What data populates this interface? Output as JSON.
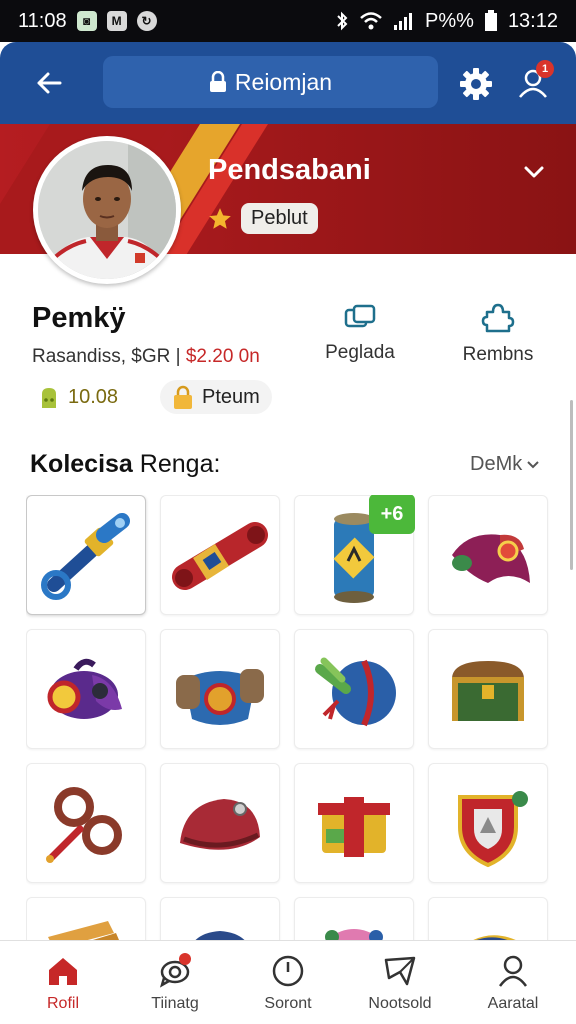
{
  "status_bar": {
    "time_left": "11:08",
    "battery_text": "P%%",
    "time_right": "13:12"
  },
  "app_bar": {
    "search_text": "Reiomjan",
    "icons": [
      "back-arrow-icon",
      "lock-icon",
      "settings-gear-icon",
      "profile-icon"
    ],
    "notification_count": "1"
  },
  "banner": {
    "name": "Pendsabani",
    "rank": "Peblut",
    "colors": {
      "primary": "#b51d21",
      "accent": "#e6a52c"
    }
  },
  "profile": {
    "name": "Pemkÿ",
    "info_prefix": "Rasandiss, $GR |",
    "price": "$2.20 0n",
    "actions": [
      {
        "label": "Peglada",
        "icon": "cards-icon"
      },
      {
        "label": "Rembns",
        "icon": "puzzle-icon"
      }
    ],
    "stats": [
      {
        "value": "10.08",
        "icon": "coin-stack-icon"
      },
      {
        "value": "Pteum",
        "icon": "lock-badge-icon"
      }
    ]
  },
  "collection": {
    "title_bold": "Kolecisa",
    "title_rest": "Renga:",
    "sort_label": "DeMk",
    "items": [
      {
        "name": "blue-key"
      },
      {
        "name": "red-scroll"
      },
      {
        "name": "potion-can",
        "badge": "+6"
      },
      {
        "name": "magic-cloak"
      },
      {
        "name": "purple-bag"
      },
      {
        "name": "blue-shield-scroll"
      },
      {
        "name": "orb-with-leaves"
      },
      {
        "name": "treasure-chest"
      },
      {
        "name": "rope-coil"
      },
      {
        "name": "red-pouch"
      },
      {
        "name": "treasure-gift"
      },
      {
        "name": "crest-shield"
      },
      {
        "name": "wood-planks"
      },
      {
        "name": "blue-helmet"
      },
      {
        "name": "pink-potion"
      },
      {
        "name": "gold-item"
      }
    ]
  },
  "bottom_nav": {
    "items": [
      {
        "label": "Rofil",
        "icon": "home-icon",
        "active": true
      },
      {
        "label": "Tiinatg",
        "icon": "chat-icon",
        "active": false
      },
      {
        "label": "Soront",
        "icon": "clock-icon",
        "active": false
      },
      {
        "label": "Nootsold",
        "icon": "map-icon",
        "active": false
      },
      {
        "label": "Aaratal",
        "icon": "person-icon",
        "active": false
      }
    ]
  }
}
